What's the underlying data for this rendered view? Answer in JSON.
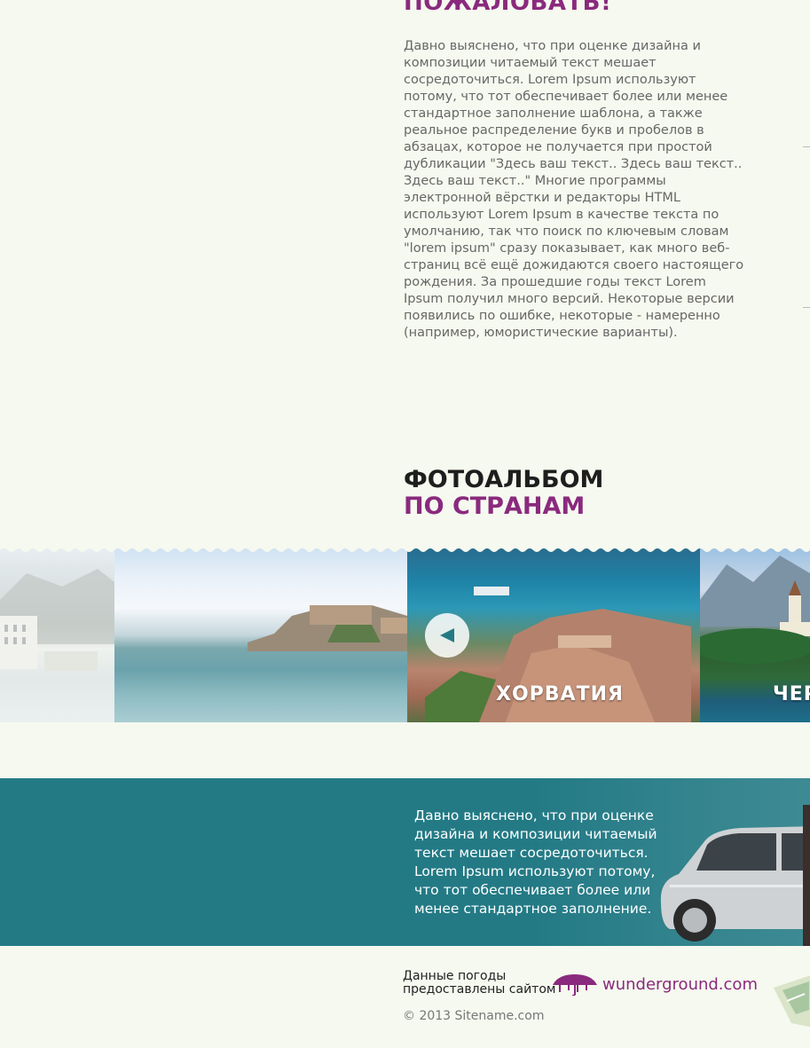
{
  "welcome": {
    "title": "ПОЖАЛОВАТЬ!",
    "text": "Давно выяснено, что при оценке дизайна и композиции читаемый текст мешает сосредоточиться. Lorem Ipsum используют потому, что тот обеспечивает более или менее стандартное заполнение шаблона, а также реальное распределение букв и пробелов в абзацах, которое не получается при простой дубликации \"Здесь ваш текст.. Здесь ваш текст.. Здесь ваш текст..\" Многие программы электронной вёрстки и редакторы HTML используют Lorem Ipsum в качестве текста по умолчанию, так что поиск по ключевым словам \"lorem ipsum\" сразу показывает, как много веб-страниц всё ещё дожидаются своего настоящего рождения. За прошедшие годы текст Lorem Ipsum получил много версий. Некоторые версии появились по ошибке, некоторые - намеренно (например, юмористические варианты)."
  },
  "album": {
    "title_line1": "ФОТОАЛЬБОМ",
    "title_line2": "ПО СТРАНАМ",
    "photos": [
      {
        "caption": ""
      },
      {
        "caption": ""
      },
      {
        "caption": "ХОРВАТИЯ"
      },
      {
        "caption": "ЧЕР"
      }
    ],
    "prev_icon": "chevron-left-icon"
  },
  "promo": {
    "text": "Давно выяснено, что при оценке дизайна и композиции читаемый текст мешает сосредоточиться. Lorem Ipsum используют потому, что тот обеспечивает более или менее стандартное заполнение."
  },
  "footer": {
    "weather_line1": "Данные погоды",
    "weather_line2": "предоставлены сайтом",
    "weather_brand": "wunderground.com",
    "copyright": "© 2013 Sitename.com"
  },
  "colors": {
    "accent": "#8a2a7e",
    "promo_bg": "#237a85",
    "page_bg": "#f6f9ef"
  }
}
